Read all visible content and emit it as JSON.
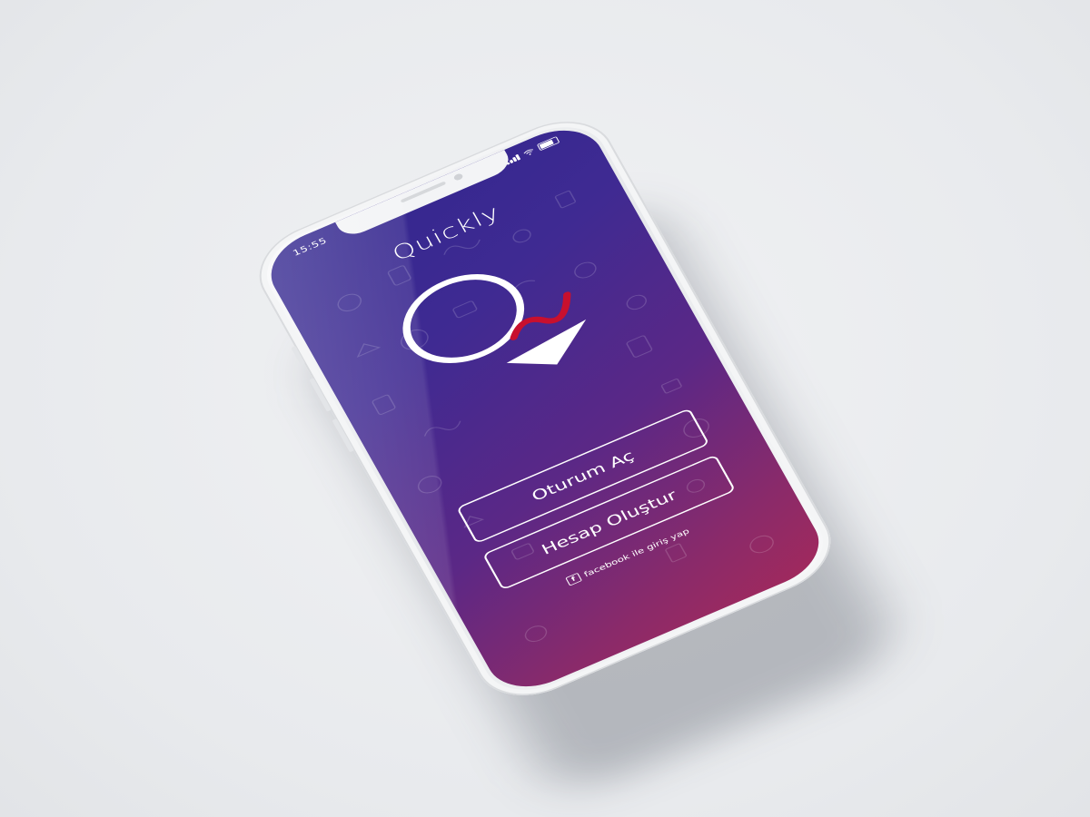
{
  "status_bar": {
    "time": "15:55",
    "icons": [
      "signal-icon",
      "wifi-icon",
      "battery-icon"
    ]
  },
  "app": {
    "title": "Quickly"
  },
  "buttons": {
    "login_label": "Oturum Aç",
    "register_label": "Hesap Oluştur"
  },
  "facebook": {
    "icon_glyph": "f",
    "label": "facebook ile giriş yap"
  },
  "colors": {
    "gradient_start": "#32278f",
    "gradient_end": "#a2295c",
    "logo_accent": "#c8102e",
    "foreground": "#ffffff"
  }
}
